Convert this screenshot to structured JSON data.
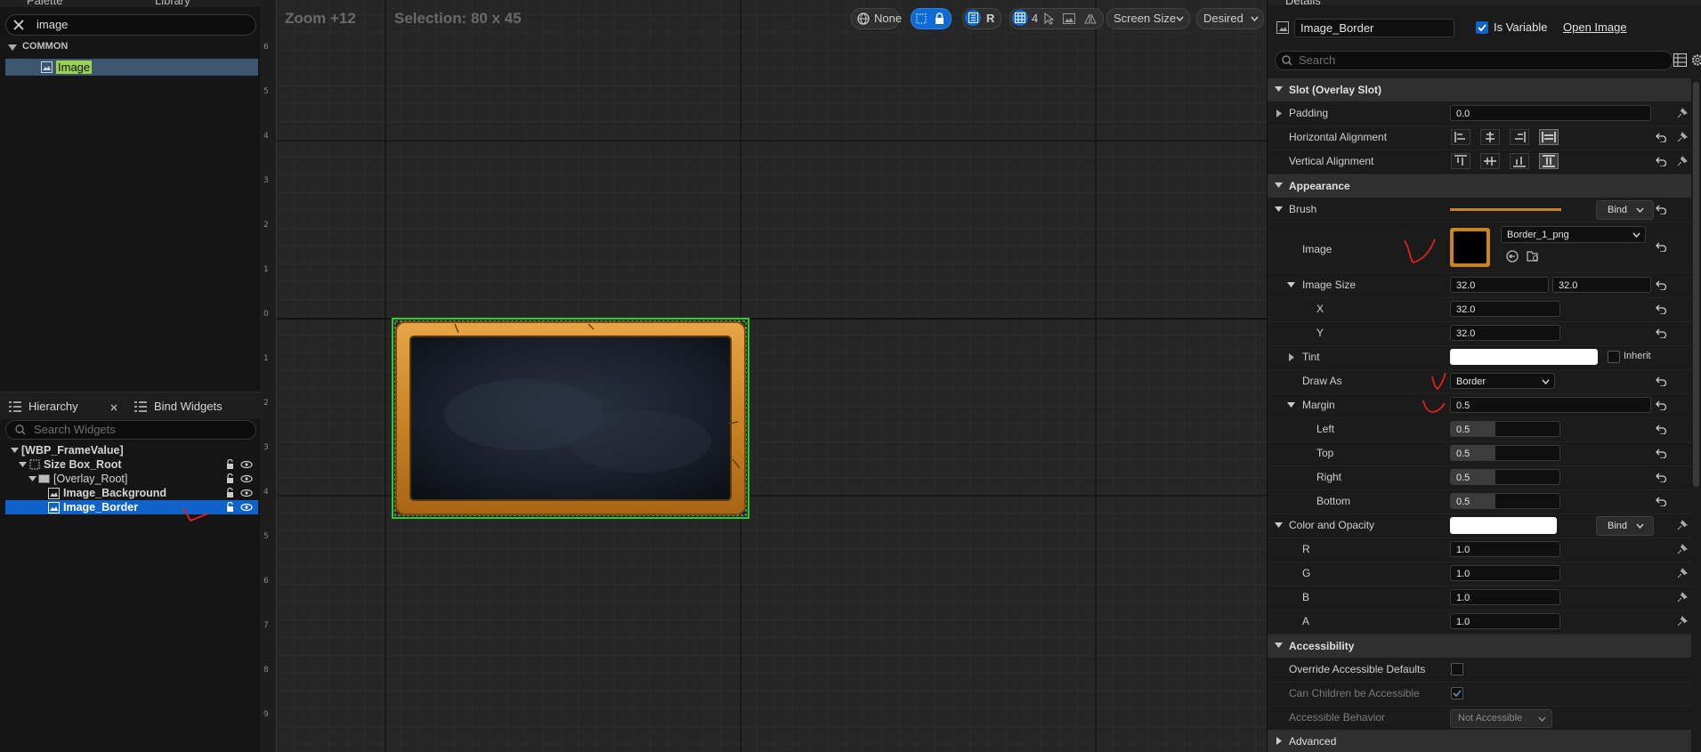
{
  "palette": {
    "tab_palette": "Palette",
    "tab_library": "Library",
    "search_value": "image",
    "category": "COMMON",
    "items": [
      {
        "label": "Image"
      }
    ]
  },
  "hierarchy": {
    "tab_hierarchy": "Hierarchy",
    "tab_bind": "Bind Widgets",
    "search_placeholder": "Search Widgets",
    "items": [
      {
        "label": "[WBP_FrameValue]"
      },
      {
        "label": "Size Box_Root"
      },
      {
        "label": "[Overlay_Root]"
      },
      {
        "label": "Image_Background"
      },
      {
        "label": "Image_Border"
      }
    ]
  },
  "viewport": {
    "zoom": "Zoom +12",
    "selection": "Selection: 80 x 45",
    "toolbar": {
      "none": "None",
      "r": "R",
      "grid_value": "4",
      "screen_size": "Screen Size",
      "desired": "Desired"
    },
    "ruler_left": [
      "6",
      "5",
      "4",
      "3",
      "2",
      "1",
      "0",
      "1",
      "2",
      "3",
      "4",
      "5",
      "6",
      "7",
      "8",
      "9"
    ]
  },
  "details": {
    "tab": "Details",
    "name_value": "Image_Border",
    "is_variable": "Is Variable",
    "open_image": "Open Image",
    "search_placeholder": "Search",
    "sections": {
      "slot": "Slot (Overlay Slot)",
      "appearance": "Appearance",
      "accessibility": "Accessibility",
      "advanced": "Advanced"
    },
    "slot": {
      "padding_label": "Padding",
      "padding_value": "0.0",
      "halign_label": "Horizontal Alignment",
      "valign_label": "Vertical Alignment"
    },
    "appearance": {
      "brush_label": "Brush",
      "bind": "Bind",
      "image_label": "Image",
      "image_asset": "Border_1_png",
      "image_size_label": "Image Size",
      "image_size_x": "32.0",
      "image_size_y": "32.0",
      "x_label": "X",
      "x_value": "32.0",
      "y_label": "Y",
      "y_value": "32.0",
      "tint_label": "Tint",
      "inherit": "Inherit",
      "draw_as_label": "Draw As",
      "draw_as_value": "Border",
      "margin_label": "Margin",
      "margin_value": "0.5",
      "left_label": "Left",
      "left_value": "0.5",
      "top_label": "Top",
      "top_value": "0.5",
      "right_label": "Right",
      "right_value": "0.5",
      "bottom_label": "Bottom",
      "bottom_value": "0.5",
      "color_label": "Color and Opacity",
      "color_bind": "Bind",
      "r_label": "R",
      "r_value": "1.0",
      "g_label": "G",
      "g_value": "1.0",
      "b_label": "B",
      "b_value": "1.0",
      "a_label": "A",
      "a_value": "1.0"
    },
    "accessibility": {
      "override_label": "Override Accessible Defaults",
      "children_label": "Can Children be Accessible",
      "behavior_label": "Accessible Behavior",
      "behavior_value": "Not Accessible"
    }
  },
  "colors": {
    "accent": "#0e62c9",
    "frame_gold": "#c9892a",
    "selection_green": "#2ecc2e",
    "annotation_red": "#e0201e"
  }
}
